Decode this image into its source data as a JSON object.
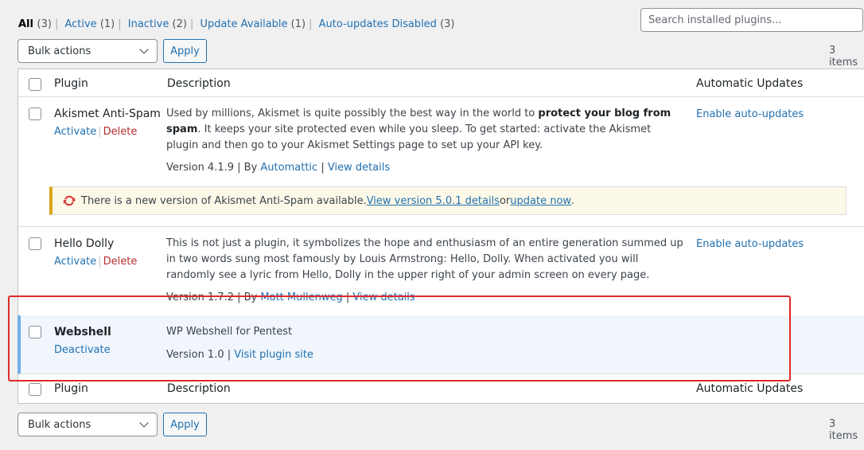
{
  "filters": {
    "all": {
      "label": "All",
      "count": "(3)"
    },
    "active": {
      "label": "Active",
      "count": "(1)"
    },
    "inactive": {
      "label": "Inactive",
      "count": "(2)"
    },
    "update_available": {
      "label": "Update Available",
      "count": "(1)"
    },
    "auto_updates_disabled": {
      "label": "Auto-updates Disabled",
      "count": "(3)"
    }
  },
  "search": {
    "placeholder": "Search installed plugins..."
  },
  "bulk": {
    "label": "Bulk actions",
    "apply": "Apply"
  },
  "items_count": "3 items",
  "columns": {
    "plugin": "Plugin",
    "description": "Description",
    "auto_updates": "Automatic Updates"
  },
  "plugins": [
    {
      "name": "Akismet Anti-Spam",
      "actions": {
        "activate": "Activate",
        "delete": "Delete",
        "sep": "|"
      },
      "desc_pre": "Used by millions, Akismet is quite possibly the best way in the world to ",
      "desc_bold": "protect your blog from spam",
      "desc_post": ". It keeps your site protected even while you sleep. To get started: activate the Akismet plugin and then go to your Akismet Settings page to set up your API key.",
      "version": "Version 4.1.9 | By ",
      "author": "Automattic",
      "sep": " | ",
      "details": "View details",
      "auto_update": "Enable auto-updates",
      "notice": {
        "text": "There is a new version of Akismet Anti-Spam available. ",
        "link1": "View version 5.0.1 details",
        "or": " or ",
        "link2": "update now",
        "end": "."
      }
    },
    {
      "name": "Hello Dolly",
      "actions": {
        "activate": "Activate",
        "delete": "Delete",
        "sep": "|"
      },
      "desc": "This is not just a plugin, it symbolizes the hope and enthusiasm of an entire generation summed up in two words sung most famously by Louis Armstrong: Hello, Dolly. When activated you will randomly see a lyric from Hello, Dolly in the upper right of your admin screen on every page.",
      "version": "Version 1.7.2 | By ",
      "author": "Matt Mullenweg",
      "sep": " | ",
      "details": "View details",
      "auto_update": "Enable auto-updates"
    },
    {
      "name": "Webshell",
      "actions": {
        "deactivate": "Deactivate"
      },
      "desc": "WP Webshell for Pentest",
      "version": "Version 1.0 | ",
      "site": "Visit plugin site"
    }
  ],
  "colors": {
    "accent": "#2271b1",
    "delete": "#b32d2e",
    "highlight": "#e0292a",
    "active_border": "#72aee6",
    "notice_border": "#dba617"
  }
}
